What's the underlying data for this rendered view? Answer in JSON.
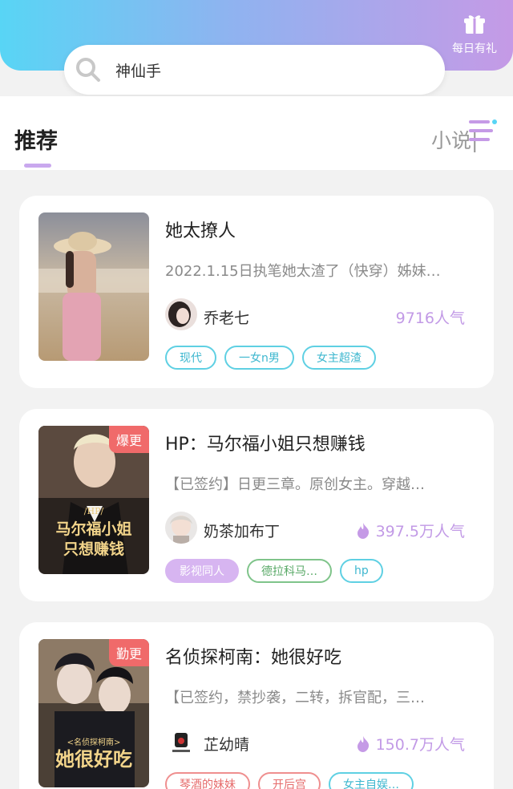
{
  "header": {
    "search_placeholder": "神仙手",
    "gift_label": "每日有礼"
  },
  "tabs": {
    "active": "推荐",
    "next_cut": "小说|"
  },
  "books": [
    {
      "title": "她太撩人",
      "desc": "2022.1.15日执笔她太渣了（快穿）姊妹…",
      "author": "乔老七",
      "popularity": "9716人气",
      "badge": "",
      "tags": [
        "现代",
        "一女n男",
        "女主超渣"
      ]
    },
    {
      "title": "HP：马尔福小姐只想赚钱",
      "desc": "【已签约】日更三章。原创女主。穿越…",
      "author": "奶茶加布丁",
      "popularity": "397.5万人气",
      "badge": "爆更",
      "cover_text": "马尔福小姐只想赚钱",
      "cover_small": "/HP/",
      "tags": [
        "影视同人",
        "德拉科马…",
        "hp"
      ]
    },
    {
      "title": "名侦探柯南：她很好吃",
      "desc": "【已签约，禁抄袭，二转，拆官配，三…",
      "author": "芷幼晴",
      "popularity": "150.7万人气",
      "badge": "勤更",
      "cover_text": "她很好吃",
      "cover_small": "<名侦探柯南>",
      "tags": [
        "琴酒的妹妹",
        "开后宫",
        "女主自娱…"
      ]
    }
  ]
}
